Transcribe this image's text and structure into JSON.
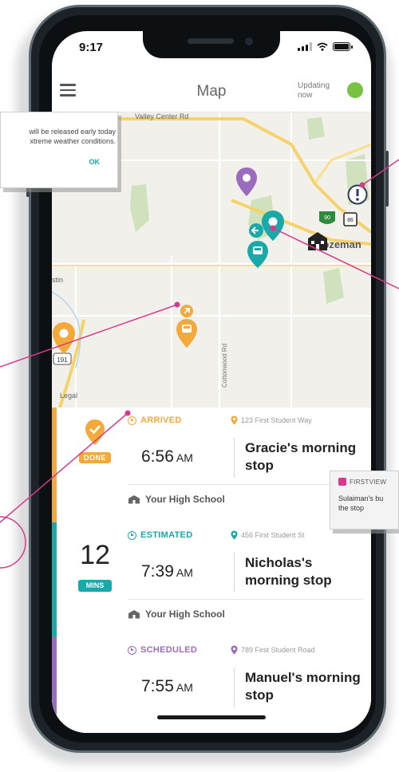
{
  "colors": {
    "accent_done": "#f4a93a",
    "accent_estimated": "#19a9a8",
    "accent_scheduled": "#9b6bbf",
    "live_indicator": "#79c143",
    "connector": "#d63a8b"
  },
  "status_bar": {
    "time": "9:17",
    "icons": [
      "signal-icon",
      "wifi-icon",
      "battery-icon"
    ]
  },
  "header": {
    "title": "Map",
    "updating_label": "Updating now",
    "menu_icon": "hamburger-icon"
  },
  "map": {
    "road_label": "Valley Center Rd",
    "vertical_road_label": "Cottonwood Rd",
    "city_label": "Bozeman",
    "route_shields": [
      "191",
      "90",
      "86"
    ],
    "legal_label": "Legal",
    "place_fragment": "stin"
  },
  "stops": [
    {
      "status": "ARRIVED",
      "address": "123 First Student Way",
      "time": "6:56",
      "ampm": "AM",
      "name": "Gracie's morning stop",
      "school": "Your High School",
      "badge": "DONE"
    },
    {
      "status": "ESTIMATED",
      "address": "456 First Student St",
      "time": "7:39",
      "ampm": "AM",
      "name": "Nicholas's morning stop",
      "school": "Your High School",
      "eta_value": "12",
      "eta_unit": "MINS"
    },
    {
      "status": "SCHEDULED",
      "address": "789 First Student Road",
      "time": "7:55",
      "ampm": "AM",
      "name": "Manuel's morning stop"
    }
  ],
  "alert_callout": {
    "message": "will be released early today\nxtreme weather conditions.",
    "ok_label": "OK"
  },
  "notification_callout": {
    "app_name": "FIRSTVIEW",
    "message": "Sulaiman's bu\nthe stop"
  }
}
